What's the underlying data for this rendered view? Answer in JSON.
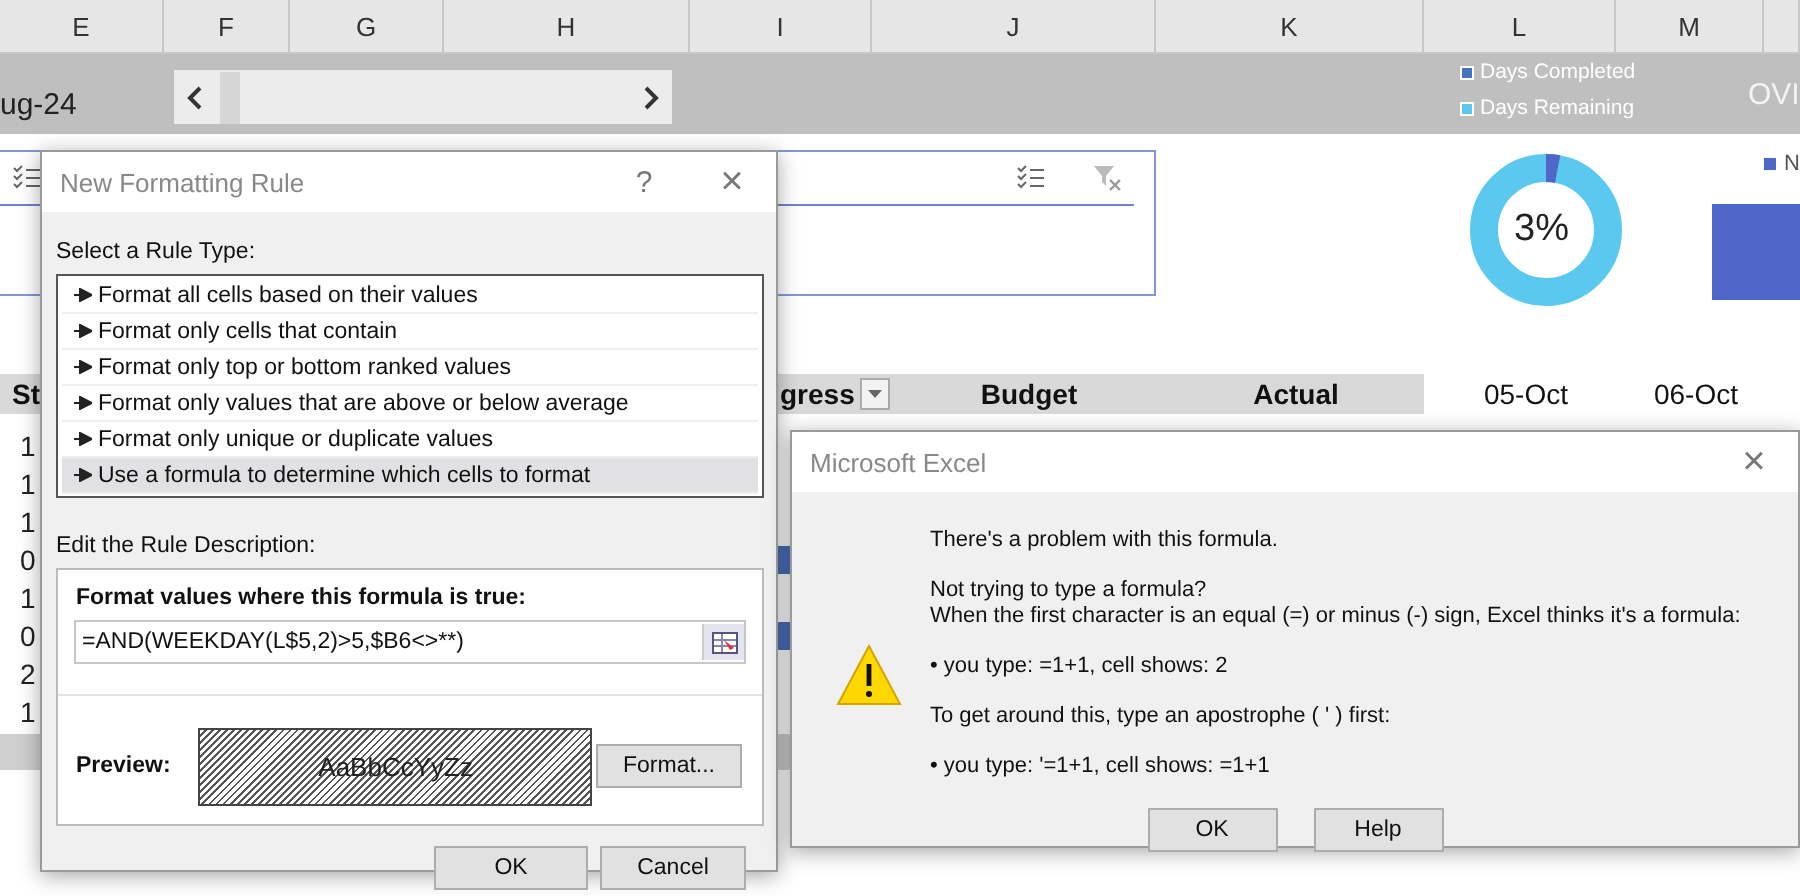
{
  "columns": [
    "E",
    "F",
    "G",
    "H",
    "I",
    "J",
    "K",
    "L",
    "M"
  ],
  "header_band": {
    "date": "ug-24",
    "legend": [
      {
        "label": "Days Completed",
        "color": "#4472c4"
      },
      {
        "label": "Days Remaining",
        "color": "#5bc8f0"
      }
    ],
    "title": "OVI"
  },
  "donut": {
    "level": 0.03,
    "reading": "3%"
  },
  "bar_legend": {
    "label": "N",
    "color": "#4f67c8"
  },
  "table": {
    "columns": [
      {
        "label": "St",
        "kind": "bold"
      },
      {
        "label": "gress",
        "kind": "filter"
      },
      {
        "label": "Budget",
        "kind": "bold"
      },
      {
        "label": "Actual",
        "kind": "bold"
      },
      {
        "label": "05-Oct",
        "kind": "plain"
      },
      {
        "label": "06-Oct",
        "kind": "plain"
      }
    ],
    "rows": [
      {
        "start": "1",
        "bar": false
      },
      {
        "start": "1",
        "bar": false
      },
      {
        "start": "1",
        "bar": false
      },
      {
        "start": "0",
        "bar": true
      },
      {
        "start": "1",
        "bar": false
      },
      {
        "start": "0",
        "bar": true
      },
      {
        "start": "2",
        "bar": false
      },
      {
        "start": "1",
        "bar": false
      }
    ]
  },
  "rule_dialog": {
    "title": "New Formatting Rule",
    "help": "?",
    "close": "×",
    "select_label": "Select a Rule Type:",
    "rule_types": [
      {
        "label": "Format all cells based on their values",
        "selected": false
      },
      {
        "label": "Format only cells that contain",
        "selected": false
      },
      {
        "label": "Format only top or bottom ranked values",
        "selected": false
      },
      {
        "label": "Format only values that are above or below average",
        "selected": false
      },
      {
        "label": "Format only unique or duplicate values",
        "selected": false
      },
      {
        "label": "Use a formula to determine which cells to format",
        "selected": true
      }
    ],
    "edit_label": "Edit the Rule Description:",
    "formula_label": "Format values where this formula is true:",
    "formula": "=AND(WEEKDAY(L$5,2)>5,$B6<>**)",
    "preview_label": "Preview:",
    "preview_sample": "AaBbCcYyZz",
    "format_button": "Format...",
    "buttons": [
      "OK",
      "Cancel"
    ]
  },
  "alert_dialog": {
    "title": "Microsoft Excel",
    "close": "×",
    "paragraphs": [
      [
        "There's a problem with this formula."
      ],
      [
        "Not trying to type a formula?",
        "When the first character is an equal (=) or minus (-) sign, Excel thinks it's a formula:"
      ],
      [
        "• you type:   =1+1, cell shows:   2"
      ],
      [
        "To get around this, type an apostrophe ( ' ) first:"
      ],
      [
        "• you type:   '=1+1, cell shows:   =1+1"
      ]
    ],
    "buttons": [
      "OK",
      "Help"
    ]
  }
}
